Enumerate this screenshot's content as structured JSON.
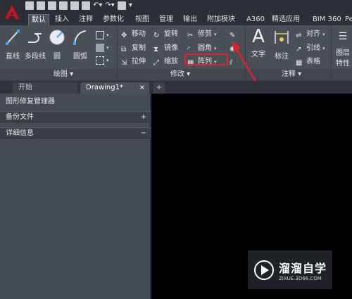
{
  "tabs": [
    "默认",
    "插入",
    "注释",
    "参数化",
    "视图",
    "管理",
    "输出",
    "附加模块",
    "A360",
    "精选应用",
    "BIM 360",
    "Perfo"
  ],
  "draw_panel": {
    "title": "绘图",
    "line": "直线",
    "polyline": "多段线",
    "circle": "圆",
    "arc": "圆弧"
  },
  "modify_panel": {
    "title": "修改",
    "move": "移动",
    "rotate": "旋转",
    "trim": "修剪",
    "copy": "复制",
    "mirror": "镜像",
    "fillet": "圆角",
    "stretch": "拉伸",
    "scale": "缩放",
    "array": "阵列"
  },
  "annotation_panel": {
    "title": "注释",
    "text": "文字",
    "dimension": "标注",
    "align": "对齐",
    "leader": "引线",
    "table": "表格"
  },
  "layers_panel": {
    "props_line1": "图层",
    "props_line2": "特性"
  },
  "file_tabs": {
    "start": "开始",
    "drawing": "Drawing1*",
    "close": "×",
    "add": "+"
  },
  "palette": {
    "title": "图形修复管理器",
    "backup": "备份文件",
    "backup_toggle": "+",
    "details": "详细信息",
    "details_toggle": "−"
  },
  "watermark": {
    "name": "溜溜自学",
    "url": "ZIXUE.3D66.COM"
  },
  "colors": {
    "highlight": "#e0202a",
    "arrow": "#e0202a",
    "app_logo": "#c8151b"
  }
}
